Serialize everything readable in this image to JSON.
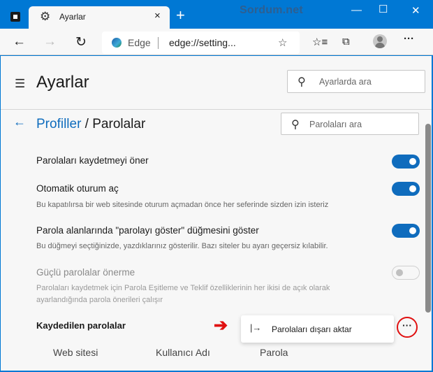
{
  "window": {
    "tab_title": "Ayarlar",
    "watermark": "Sordum.net",
    "new_tab": "+",
    "tab_close": "×"
  },
  "toolbar": {
    "address_brand": "Edge",
    "address_url": "edge://setting...",
    "more": "···"
  },
  "page": {
    "title": "Ayarlar",
    "search_placeholder": "Ayarlarda ara",
    "breadcrumb_link": "Profiller",
    "breadcrumb_sep": " / ",
    "breadcrumb_current": "Parolalar",
    "password_search_placeholder": "Parolaları ara"
  },
  "settings": [
    {
      "title": "Parolaları kaydetmeyi öner",
      "desc": "",
      "enabled": true,
      "disabled": false
    },
    {
      "title": "Otomatik oturum aç",
      "desc": "Bu kapatılırsa bir web sitesinde oturum açmadan önce her seferinde sizden izin isteriz",
      "enabled": true,
      "disabled": false
    },
    {
      "title": "Parola alanlarında \"parolayı göster\" düğmesini göster",
      "desc": "Bu düğmeyi seçtiğinizde, yazdıklarınız gösterilir. Bazı siteler bu ayarı geçersiz kılabilir.",
      "enabled": true,
      "disabled": false
    },
    {
      "title": "Güçlü parolalar önerme",
      "desc": "Parolaları kaydetmek için Parola Eşitleme ve Teklif özelliklerinin her ikisi de açık olarak ayarlandığında parola önerileri çalışır",
      "enabled": false,
      "disabled": true
    }
  ],
  "saved": {
    "title": "Kaydedilen parolalar",
    "menu_item": "Parolaları dışarı aktar",
    "more_label": "···",
    "columns": [
      "Web sitesi",
      "Kullanıcı Adı",
      "Parola"
    ]
  },
  "colors": {
    "accent": "#0f6cbd",
    "titlebar": "#0078d4",
    "annotation": "#e01010"
  }
}
